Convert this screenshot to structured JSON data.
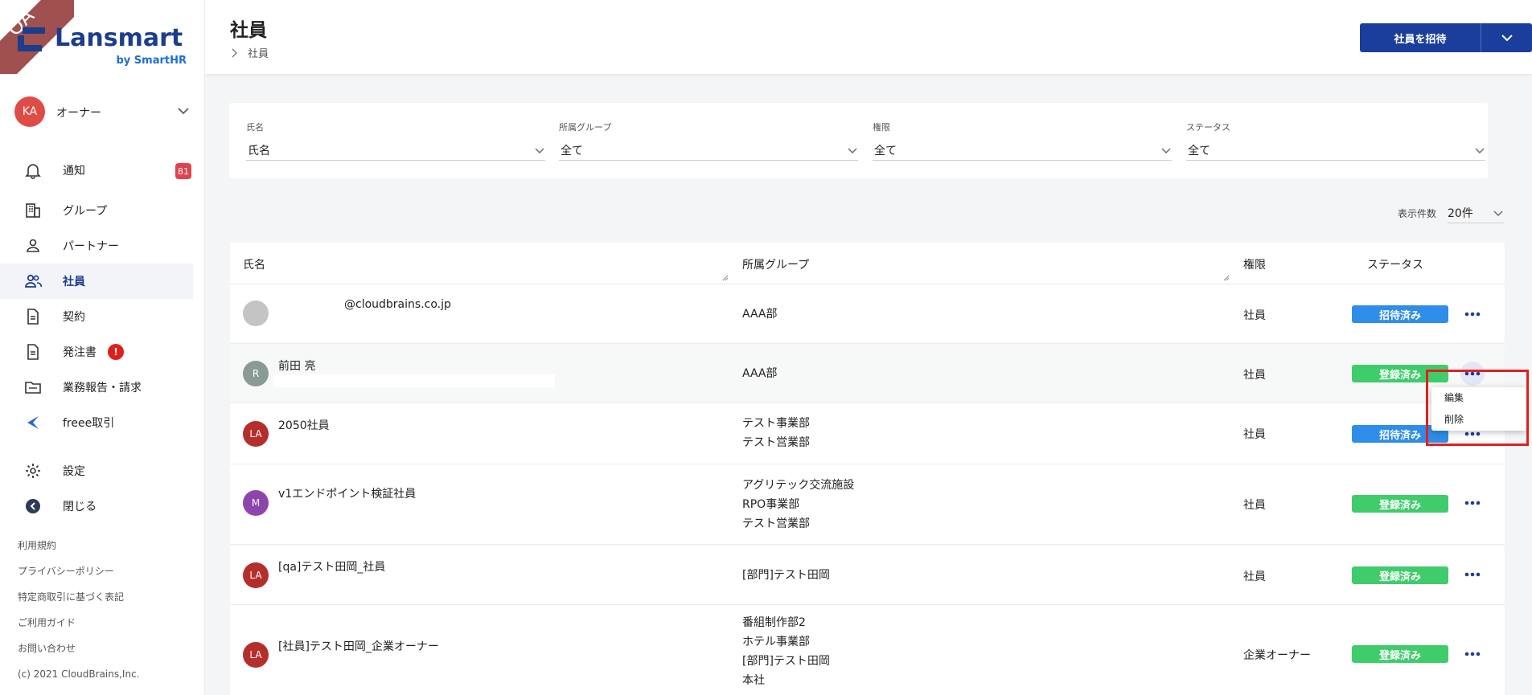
{
  "brand": {
    "badge": "QA",
    "name": "Lansmart",
    "sub": "by SmartHR"
  },
  "account": {
    "initials": "KA",
    "name": "オーナー"
  },
  "nav": [
    {
      "label": "通知",
      "icon": "bell-icon",
      "badge": "81"
    },
    {
      "label": "グループ",
      "icon": "building-icon"
    },
    {
      "label": "パートナー",
      "icon": "person-icon"
    },
    {
      "label": "社員",
      "icon": "people-icon",
      "active": true
    },
    {
      "label": "契約",
      "icon": "document-icon"
    },
    {
      "label": "発注書",
      "icon": "document-icon",
      "alert": "!"
    },
    {
      "label": "業務報告・請求",
      "icon": "folder-icon"
    },
    {
      "label": "freee取引",
      "icon": "freee-icon"
    },
    {
      "label": "設定",
      "icon": "gear-icon"
    },
    {
      "label": "閉じる",
      "icon": "back-circle-icon"
    }
  ],
  "footer": {
    "links": [
      "利用規約",
      "プライバシーポリシー",
      "特定商取引に基づく表記",
      "ご利用ガイド",
      "お問い合わせ"
    ],
    "copyright": "(c) 2021 CloudBrains,Inc."
  },
  "header": {
    "title": "社員",
    "breadcrumb": "社員",
    "invite_label": "社員を招待"
  },
  "filters": [
    {
      "label": "氏名",
      "value": "氏名"
    },
    {
      "label": "所属グループ",
      "value": "全て"
    },
    {
      "label": "権限",
      "value": "全て"
    },
    {
      "label": "ステータス",
      "value": "全て"
    }
  ],
  "per_page": {
    "label": "表示件数",
    "value": "20件"
  },
  "table": {
    "columns": [
      "氏名",
      "所属グループ",
      "権限",
      "ステータス"
    ],
    "rows": [
      {
        "initials": "",
        "avatar_color": "#c4c4c4",
        "name": "@cloudbrains.co.jp",
        "groups": [
          "AAA部"
        ],
        "role": "社員",
        "status": "招待済み",
        "status_color": "blue"
      },
      {
        "initials": "R",
        "avatar_color": "#8a9a94",
        "name": "前田 亮",
        "groups": [
          "AAA部"
        ],
        "role": "社員",
        "status": "登録済み",
        "status_color": "green"
      },
      {
        "initials": "LA",
        "avatar_color": "#b42f2c",
        "name": "2050社員",
        "groups": [
          "テスト事業部",
          "テスト営業部"
        ],
        "role": "社員",
        "status": "招待済み",
        "status_color": "blue"
      },
      {
        "initials": "M",
        "avatar_color": "#8e44ad",
        "name": "v1エンドポイント検証社員",
        "groups": [
          "アグリテック交流施設",
          "RPO事業部",
          "テスト営業部"
        ],
        "role": "社員",
        "status": "登録済み",
        "status_color": "green"
      },
      {
        "initials": "LA",
        "avatar_color": "#b42f2c",
        "name": "[qa]テスト田岡_社員",
        "groups": [
          "[部門]テスト田岡"
        ],
        "role": "社員",
        "status": "登録済み",
        "status_color": "green"
      },
      {
        "initials": "LA",
        "avatar_color": "#b42f2c",
        "name": "[社員]テスト田岡_企業オーナー",
        "groups": [
          "番組制作部2",
          "ホテル事業部",
          "[部門]テスト田岡",
          "本社"
        ],
        "role": "企業オーナー",
        "status": "登録済み",
        "status_color": "green"
      }
    ]
  },
  "context_menu": {
    "items": [
      "編集",
      "削除"
    ]
  },
  "colors": {
    "primary": "#1b3e9c",
    "invited": "#2e8de8",
    "registered": "#3fcc6a",
    "highlight": "#e0201e"
  }
}
